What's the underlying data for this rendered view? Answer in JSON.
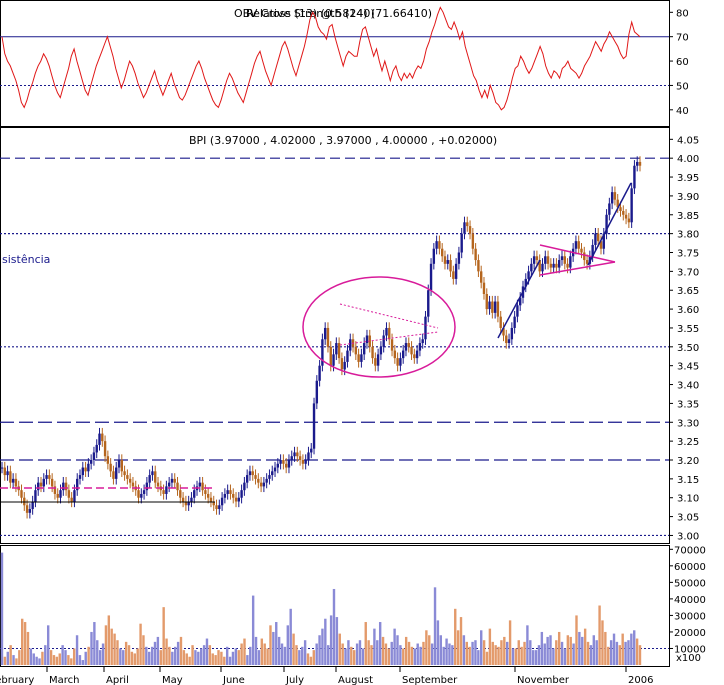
{
  "chart_data": [
    {
      "type": "line",
      "title": "Relative Strength (14) (71.66410)",
      "overlay_title": "OBV Cross (13) (0.58240)",
      "ylim": [
        35,
        83
      ],
      "ytick_labels": [
        "40",
        "50",
        "60",
        "70",
        "80"
      ],
      "yticks": [
        40,
        50,
        60,
        70,
        80
      ],
      "reference_lines": [
        70,
        50
      ],
      "series": [
        {
          "color": "#e01818",
          "values": [
            70,
            63,
            60,
            58,
            55,
            52,
            48,
            43,
            41,
            44,
            48,
            51,
            55,
            58,
            60,
            63,
            61,
            58,
            54,
            50,
            47,
            45,
            49,
            53,
            57,
            62,
            65,
            60,
            56,
            52,
            48,
            46,
            50,
            54,
            58,
            61,
            64,
            67,
            70,
            66,
            62,
            57,
            53,
            49,
            52,
            56,
            60,
            58,
            55,
            51,
            48,
            45,
            47,
            50,
            53,
            56,
            52,
            49,
            46,
            49,
            52,
            55,
            51,
            48,
            45,
            44,
            46,
            49,
            52,
            55,
            58,
            60,
            57,
            53,
            50,
            47,
            44,
            42,
            41,
            44,
            48,
            52,
            55,
            53,
            50,
            47,
            45,
            43,
            47,
            51,
            55,
            59,
            62,
            64,
            60,
            56,
            53,
            50,
            54,
            58,
            62,
            66,
            68,
            65,
            61,
            57,
            54,
            58,
            62,
            66,
            71,
            77,
            80,
            78,
            74,
            72,
            71,
            69,
            74,
            75,
            70,
            66,
            62,
            58,
            62,
            64,
            63,
            62,
            62,
            68,
            73,
            74,
            70,
            66,
            62,
            65,
            60,
            56,
            60,
            56,
            52,
            56,
            58,
            54,
            52,
            55,
            53,
            55,
            53,
            56,
            58,
            57,
            60,
            65,
            68,
            72,
            75,
            79,
            82,
            80,
            77,
            74,
            73,
            76,
            73,
            69,
            72,
            66,
            62,
            58,
            54,
            52,
            48,
            45,
            48,
            45,
            50,
            47,
            43,
            42,
            40,
            41,
            44,
            48,
            53,
            57,
            58,
            62,
            60,
            57,
            55,
            57,
            60,
            63,
            66,
            63,
            58,
            55,
            53,
            56,
            55,
            53,
            57,
            58,
            60,
            57,
            56,
            55,
            53,
            55,
            58,
            60,
            62,
            65,
            68,
            66,
            64,
            67,
            69,
            72,
            70,
            68,
            66,
            63,
            61,
            62,
            71,
            76,
            72,
            71,
            70
          ]
        }
      ]
    },
    {
      "type": "candlestick",
      "title": "BPI (3.97000 , 4.02000 , 3.97000 , 4.00000 , +0.02000)",
      "ylim": [
        2.98,
        4.08
      ],
      "ytick_labels": [
        "3.00",
        "3.05",
        "3.10",
        "3.15",
        "3.20",
        "3.25",
        "3.30",
        "3.35",
        "3.40",
        "3.45",
        "3.50",
        "3.55",
        "3.60",
        "3.65",
        "3.70",
        "3.75",
        "3.80",
        "3.85",
        "3.90",
        "3.95",
        "4.00",
        "4.05"
      ],
      "yticks": [
        3.0,
        3.05,
        3.1,
        3.15,
        3.2,
        3.25,
        3.3,
        3.35,
        3.4,
        3.45,
        3.5,
        3.55,
        3.6,
        3.65,
        3.7,
        3.75,
        3.8,
        3.85,
        3.9,
        3.95,
        4.0,
        4.05
      ],
      "close": [
        3.18,
        3.16,
        3.17,
        3.14,
        3.15,
        3.13,
        3.12,
        3.1,
        3.08,
        3.06,
        3.07,
        3.09,
        3.12,
        3.14,
        3.13,
        3.15,
        3.16,
        3.15,
        3.13,
        3.11,
        3.1,
        3.12,
        3.14,
        3.12,
        3.1,
        3.09,
        3.12,
        3.15,
        3.16,
        3.18,
        3.17,
        3.19,
        3.2,
        3.22,
        3.24,
        3.27,
        3.25,
        3.21,
        3.19,
        3.17,
        3.15,
        3.18,
        3.2,
        3.17,
        3.16,
        3.15,
        3.14,
        3.13,
        3.12,
        3.1,
        3.11,
        3.12,
        3.14,
        3.16,
        3.17,
        3.14,
        3.13,
        3.12,
        3.11,
        3.13,
        3.14,
        3.15,
        3.14,
        3.12,
        3.1,
        3.09,
        3.08,
        3.09,
        3.1,
        3.12,
        3.13,
        3.14,
        3.12,
        3.11,
        3.1,
        3.09,
        3.08,
        3.07,
        3.08,
        3.1,
        3.11,
        3.12,
        3.11,
        3.1,
        3.09,
        3.1,
        3.12,
        3.14,
        3.16,
        3.17,
        3.16,
        3.15,
        3.14,
        3.13,
        3.14,
        3.15,
        3.16,
        3.17,
        3.18,
        3.19,
        3.2,
        3.19,
        3.18,
        3.2,
        3.21,
        3.22,
        3.21,
        3.2,
        3.19,
        3.2,
        3.22,
        3.23,
        3.35,
        3.41,
        3.45,
        3.52,
        3.55,
        3.5,
        3.45,
        3.48,
        3.51,
        3.47,
        3.44,
        3.46,
        3.49,
        3.52,
        3.5,
        3.48,
        3.46,
        3.48,
        3.51,
        3.53,
        3.5,
        3.47,
        3.45,
        3.48,
        3.5,
        3.53,
        3.55,
        3.52,
        3.49,
        3.47,
        3.45,
        3.47,
        3.49,
        3.51,
        3.5,
        3.48,
        3.47,
        3.49,
        3.51,
        3.52,
        3.58,
        3.65,
        3.72,
        3.76,
        3.78,
        3.76,
        3.74,
        3.72,
        3.73,
        3.7,
        3.68,
        3.72,
        3.75,
        3.8,
        3.83,
        3.82,
        3.8,
        3.76,
        3.73,
        3.7,
        3.67,
        3.64,
        3.6,
        3.62,
        3.59,
        3.62,
        3.58,
        3.55,
        3.53,
        3.51,
        3.52,
        3.55,
        3.58,
        3.61,
        3.63,
        3.66,
        3.68,
        3.7,
        3.72,
        3.74,
        3.73,
        3.7,
        3.72,
        3.74,
        3.72,
        3.71,
        3.72,
        3.71,
        3.73,
        3.74,
        3.72,
        3.71,
        3.74,
        3.76,
        3.78,
        3.76,
        3.75,
        3.73,
        3.72,
        3.74,
        3.77,
        3.8,
        3.78,
        3.76,
        3.8,
        3.85,
        3.88,
        3.91,
        3.89,
        3.87,
        3.86,
        3.85,
        3.84,
        3.83,
        3.92,
        3.98,
        3.99,
        3.98
      ]
    },
    {
      "type": "bar",
      "title": "Volume",
      "ylim": [
        0,
        72000
      ],
      "ytick_labels": [
        "10000",
        "20000",
        "30000",
        "40000",
        "50000",
        "60000",
        "70000"
      ],
      "yticks": [
        10000,
        20000,
        30000,
        40000,
        50000,
        60000,
        70000
      ],
      "unit_label": "x100",
      "values": [
        68000,
        5000,
        8000,
        12000,
        6000,
        4000,
        9000,
        28000,
        26000,
        20000,
        10000,
        7000,
        5000,
        4000,
        8000,
        12000,
        24000,
        9000,
        6000,
        5000,
        7000,
        12000,
        9000,
        6000,
        4000,
        10000,
        18000,
        6000,
        3000,
        8000,
        11000,
        20000,
        26000,
        15000,
        9000,
        13000,
        24000,
        30000,
        22000,
        19000,
        15000,
        10000,
        9000,
        14000,
        12000,
        8000,
        7000,
        10000,
        25000,
        18000,
        11000,
        8000,
        11000,
        14000,
        17000,
        9000,
        35000,
        16000,
        11000,
        8000,
        11000,
        14000,
        17000,
        9000,
        7000,
        5000,
        12000,
        9000,
        8000,
        10000,
        12000,
        16000,
        12000,
        7000,
        6000,
        9000,
        8000,
        5000,
        11000,
        5000,
        8000,
        10000,
        9000,
        13000,
        16000,
        6000,
        11000,
        42000,
        17000,
        9000,
        16000,
        13000,
        10000,
        24000,
        20000,
        26000,
        17000,
        13000,
        11000,
        24000,
        34000,
        19000,
        12000,
        9000,
        11000,
        15000,
        7000,
        5000,
        9000,
        13000,
        18000,
        22000,
        28000,
        12000,
        30000,
        46000,
        29000,
        19000,
        13000,
        10000,
        15000,
        11000,
        9000,
        13000,
        15000,
        10000,
        26000,
        15000,
        12000,
        22000,
        15000,
        26000,
        17000,
        13000,
        10000,
        14000,
        22000,
        18000,
        12000,
        10000,
        17000,
        14000,
        11000,
        10000,
        13000,
        11000,
        14000,
        21000,
        18000,
        13000,
        47000,
        27000,
        18000,
        11000,
        16000,
        13000,
        12000,
        34000,
        21000,
        29000,
        18000,
        14000,
        11000,
        14000,
        15000,
        9000,
        21000,
        15000,
        8000,
        22000,
        14000,
        12000,
        11000,
        15000,
        17000,
        14000,
        27000,
        10000,
        10000,
        15000,
        11000,
        14000,
        24000,
        15000,
        9000,
        9000,
        12000,
        20000,
        13000,
        17000,
        18000,
        10000,
        15000,
        20000,
        14000,
        10000,
        18000,
        17000,
        13000,
        30000,
        20000,
        17000,
        22000,
        14000,
        12000,
        18000,
        15000,
        36000,
        27000,
        20000,
        11000,
        15000,
        19000,
        14000,
        12000,
        19000,
        14000,
        15000,
        19000,
        21000,
        16000,
        12000
      ]
    },
    {
      "type": "axis",
      "x_labels": [
        "February",
        "March",
        "April",
        "May",
        "June",
        "July",
        "August",
        "September",
        "November",
        "2006"
      ]
    }
  ],
  "annotations": {
    "resistance_label": "sistência"
  }
}
